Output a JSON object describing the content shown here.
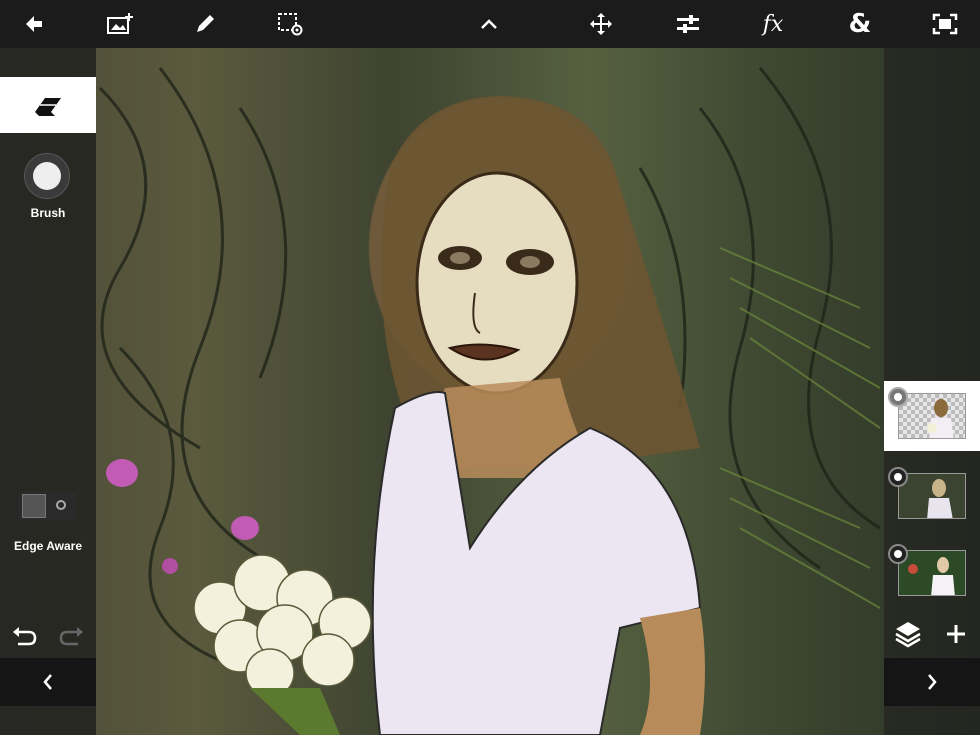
{
  "toolbar": {
    "items": [
      "back-icon",
      "add-image-icon",
      "pencil-icon",
      "selection-settings-icon",
      "chevron-up-icon",
      "move-icon",
      "adjustments-icon",
      "fx-icon",
      "ampersand-icon",
      "fullscreen-icon"
    ],
    "fx_label": "fx",
    "amp_label": "&"
  },
  "left_panel": {
    "active_tool": "eraser-icon",
    "brush_label": "Brush",
    "edge_aware_label": "Edge Aware",
    "edge_aware_on": false
  },
  "right_panel": {
    "layers": [
      {
        "name": "layer-1",
        "selected": true,
        "type": "cutout"
      },
      {
        "name": "layer-2",
        "selected": false,
        "type": "photo"
      },
      {
        "name": "layer-3",
        "selected": false,
        "type": "photo"
      }
    ]
  },
  "colors": {
    "toolbar_bg": "#1b1b1b",
    "panel_bg": "#1e1e1e",
    "active_tool_bg": "#ffffff"
  }
}
